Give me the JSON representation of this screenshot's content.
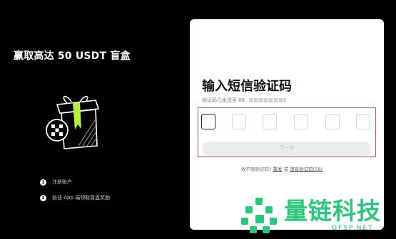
{
  "promo": {
    "title": "赢取高达 50 USDT 盲盒",
    "steps": [
      {
        "num": "1",
        "label": "注册账户"
      },
      {
        "num": "2",
        "label": "前往 App 端领取盲盒奖励"
      }
    ]
  },
  "verify": {
    "title": "输入短信验证码",
    "subtitle": "验证码已发送至 86",
    "code_digits": [
      "",
      "",
      "",
      "",
      "",
      ""
    ],
    "next_label": "下一步",
    "resend_prompt": "收不到验证码?",
    "resend_label": "重发",
    "or_label": "或",
    "voice_label": "语音验证码(59)"
  },
  "watermark": {
    "text": "量链科技",
    "url": "QFSP.NET"
  },
  "colors": {
    "accent_green": "#27c87a",
    "gift_ribbon": "#b6f23a",
    "error_border": "#d9534f"
  }
}
